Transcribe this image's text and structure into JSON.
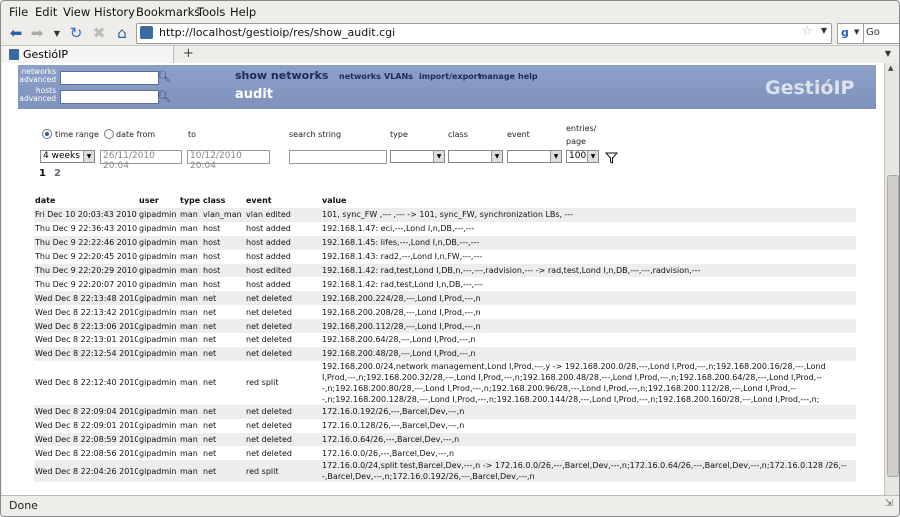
{
  "menu": [
    "File",
    "Edit",
    "View",
    "History",
    "Bookmarks",
    "Tools",
    "Help"
  ],
  "url": "http://localhost/gestioip/res/show_audit.cgi",
  "search_engine_label": "Go",
  "tab_title": "GestióIP",
  "new_tab": "+",
  "status": "Done",
  "header": {
    "networks_label": "networks",
    "networks_sub": "advanced",
    "hosts_label": "hosts",
    "hosts_sub": "advanced",
    "page_section": "show networks",
    "page_title": "audit",
    "nav": [
      "networks",
      "VLANs",
      "import/export",
      "manage",
      "help"
    ],
    "logo": "GestióIP"
  },
  "filters": {
    "time_range": "time range",
    "date_from": "date from",
    "to": "to",
    "search_string": "search string",
    "type": "type",
    "class": "class",
    "event": "event",
    "entries_label_1": "entries/",
    "entries_label_2": "page",
    "range_value": "4 weeks",
    "date_from_value": "26/11/2010 20:04",
    "date_to_value": "10/12/2010 20:04",
    "entries_value": "100"
  },
  "pages": [
    "1",
    "2"
  ],
  "columns": [
    "date",
    "user",
    "type",
    "class",
    "event",
    "value"
  ],
  "rows": [
    [
      "Fri Dec 10 20:03:43 2010",
      "gipadmin",
      "man",
      "vlan_man",
      "vlan edited",
      "101, sync_FW ,--- ,--- -> 101, sync_FW, synchronization LBs, ---"
    ],
    [
      "Thu Dec 9 22:36:43 2010",
      "gipadmin",
      "man",
      "host",
      "host added",
      "192.168.1.47: eci,---,Lond I,n,DB,---,---"
    ],
    [
      "Thu Dec 9 22:22:46 2010",
      "gipadmin",
      "man",
      "host",
      "host added",
      "192.168.1.45: lifes,---,Lond I,n,DB,---,---"
    ],
    [
      "Thu Dec 9 22:20:45 2010",
      "gipadmin",
      "man",
      "host",
      "host added",
      "192.168.1.43: rad2,---,Lond I,n,FW,---,---"
    ],
    [
      "Thu Dec 9 22:20:29 2010",
      "gipadmin",
      "man",
      "host",
      "host edited",
      "192.168.1.42: rad,test,Lond I,DB,n,---,---,radvision,--- -> rad,test,Lond I,n,DB,---,---,radvision,---"
    ],
    [
      "Thu Dec 9 22:20:07 2010",
      "gipadmin",
      "man",
      "host",
      "host added",
      "192.168.1.42: rad,test,Lond I,n,DB,---,---"
    ],
    [
      "Wed Dec 8 22:13:48 2010",
      "gipadmin",
      "man",
      "net",
      "net deleted",
      "192.168.200.224/28,---,Lond I,Prod,---,n"
    ],
    [
      "Wed Dec 8 22:13:42 2010",
      "gipadmin",
      "man",
      "net",
      "net deleted",
      "192.168.200.208/28,---,Lond I,Prod,---,n"
    ],
    [
      "Wed Dec 8 22:13:06 2010",
      "gipadmin",
      "man",
      "net",
      "net deleted",
      "192.168.200.112/28,---,Lond I,Prod,---,n"
    ],
    [
      "Wed Dec 8 22:13:01 2010",
      "gipadmin",
      "man",
      "net",
      "net deleted",
      "192.168.200.64/28,---,Lond I,Prod,---,n"
    ],
    [
      "Wed Dec 8 22:12:54 2010",
      "gipadmin",
      "man",
      "net",
      "net deleted",
      "192.168.200.48/28,---,Lond I,Prod,---,n"
    ],
    [
      "Wed Dec 8 22:12:40 2010",
      "gipadmin",
      "man",
      "net",
      "red split",
      "192.168.200.0/24,network management,Lond I,Prod,---,y -> 192.168.200.0/28,---,Lond I,Prod,---,n;192.168.200.16/28,---,Lond I,Prod,---,n;192.168.200.32/28,---,Lond I,Prod,---,n;192.168.200.48/28,---,Lond I,Prod,---,n;192.168.200.64/28,---,Lond I,Prod,---,n;192.168.200.80/28,---,Lond I,Prod,---,n;192.168.200.96/28,---,Lond I,Prod,---,n;192.168.200.112/28,---,Lond I,Prod,---,n;192.168.200.128/28,---,Lond I,Prod,---,n;192.168.200.144/28,---,Lond I,Prod,---,n;192.168.200.160/28,---,Lond I,Prod,---,n;"
    ],
    [
      "Wed Dec 8 22:09:04 2010",
      "gipadmin",
      "man",
      "net",
      "net deleted",
      "172.16.0.192/26,---,Barcel,Dev,---,n"
    ],
    [
      "Wed Dec 8 22:09:01 2010",
      "gipadmin",
      "man",
      "net",
      "net deleted",
      "172.16.0.128/26,---,Barcel,Dev,---,n"
    ],
    [
      "Wed Dec 8 22:08:59 2010",
      "gipadmin",
      "man",
      "net",
      "net deleted",
      "172.16.0.64/26,---,Barcel,Dev,---,n"
    ],
    [
      "Wed Dec 8 22:08:56 2010",
      "gipadmin",
      "man",
      "net",
      "net deleted",
      "172.16.0.0/26,---,Barcel,Dev,---,n"
    ],
    [
      "Wed Dec 8 22:04:26 2010",
      "gipadmin",
      "man",
      "net",
      "red split",
      "172.16.0.0/24,split test,Barcel,Dev,---,n -> 172.16.0.0/26,---,Barcel,Dev,---,n;172.16.0.64/26,---,Barcel,Dev,---,n;172.16.0.128 /26,---,Barcel,Dev,---,n;172.16.0.192/26,---,Barcel,Dev,---,n"
    ]
  ]
}
